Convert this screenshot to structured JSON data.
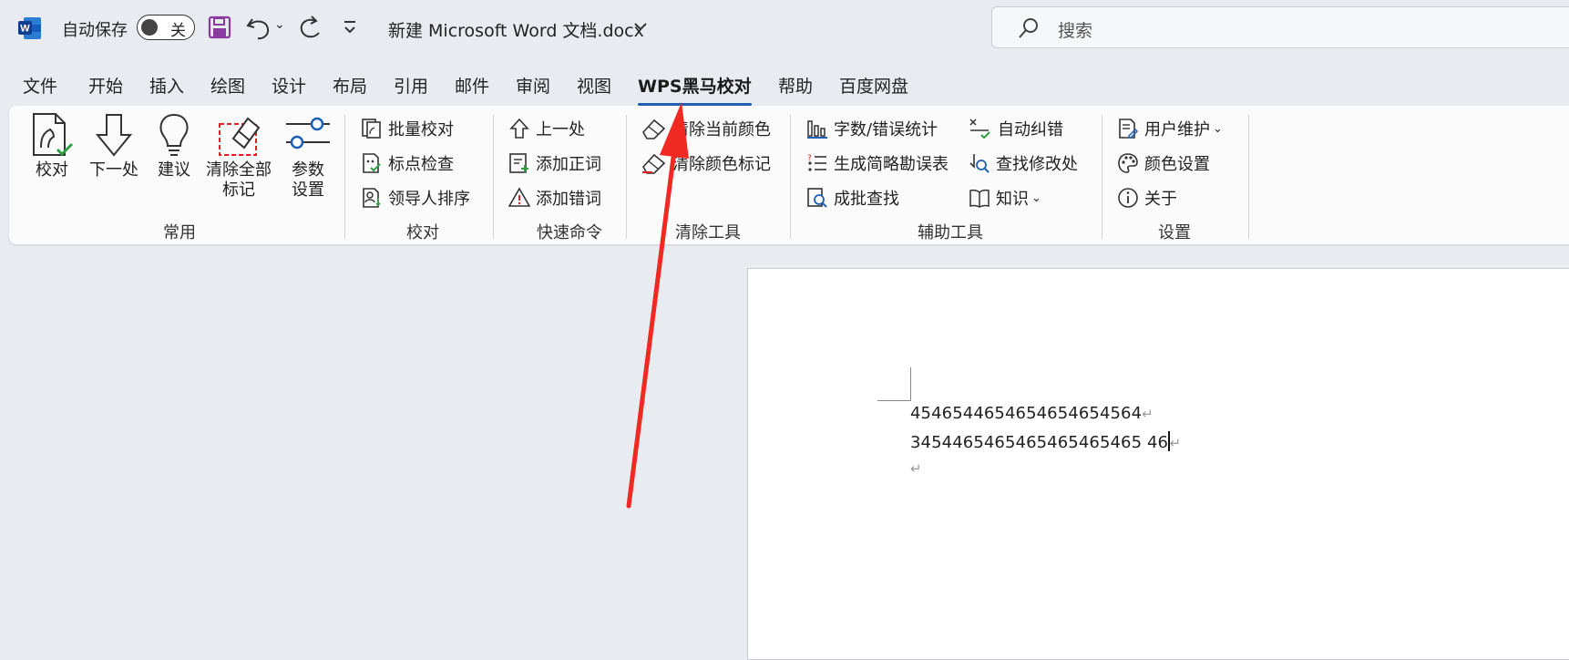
{
  "titlebar": {
    "autosave_label": "自动保存",
    "autosave_state": "关",
    "doc_title": "新建 Microsoft Word 文档.docx",
    "search_placeholder": "搜索"
  },
  "tabs": [
    "文件",
    "开始",
    "插入",
    "绘图",
    "设计",
    "布局",
    "引用",
    "邮件",
    "审阅",
    "视图",
    "WPS黑马校对",
    "帮助",
    "百度网盘"
  ],
  "active_tab": "WPS黑马校对",
  "ribbon": {
    "common": {
      "label": "常用",
      "buttons": [
        "校对",
        "下一处",
        "建议",
        "清除全部",
        "标记",
        "参数",
        "设置"
      ]
    },
    "proofread": {
      "label": "校对",
      "buttons": [
        "批量校对",
        "标点检查",
        "领导人排序"
      ]
    },
    "quick": {
      "label": "快速命令",
      "buttons": [
        "上一处",
        "添加正词",
        "添加错词"
      ]
    },
    "clear": {
      "label": "清除工具",
      "buttons": [
        "清除当前颜色",
        "清除颜色标记"
      ]
    },
    "aux": {
      "label": "辅助工具",
      "buttons": [
        "字数/错误统计",
        "生成简略勘误表",
        "成批查找",
        "自动纠错",
        "查找修改处",
        "知识"
      ]
    },
    "settings": {
      "label": "设置",
      "buttons": [
        "用户维护",
        "颜色设置",
        "关于"
      ]
    }
  },
  "document": {
    "lines": [
      "4546544654654654654564",
      "3454465465465465465465 46"
    ]
  },
  "colors": {
    "accent": "#1f5fb4",
    "annotation_arrow": "#f02a22",
    "word_blue": "#185abd",
    "check_green": "#2ea043",
    "marker_red": "#e02020",
    "save_purple": "#8a3aa0"
  }
}
